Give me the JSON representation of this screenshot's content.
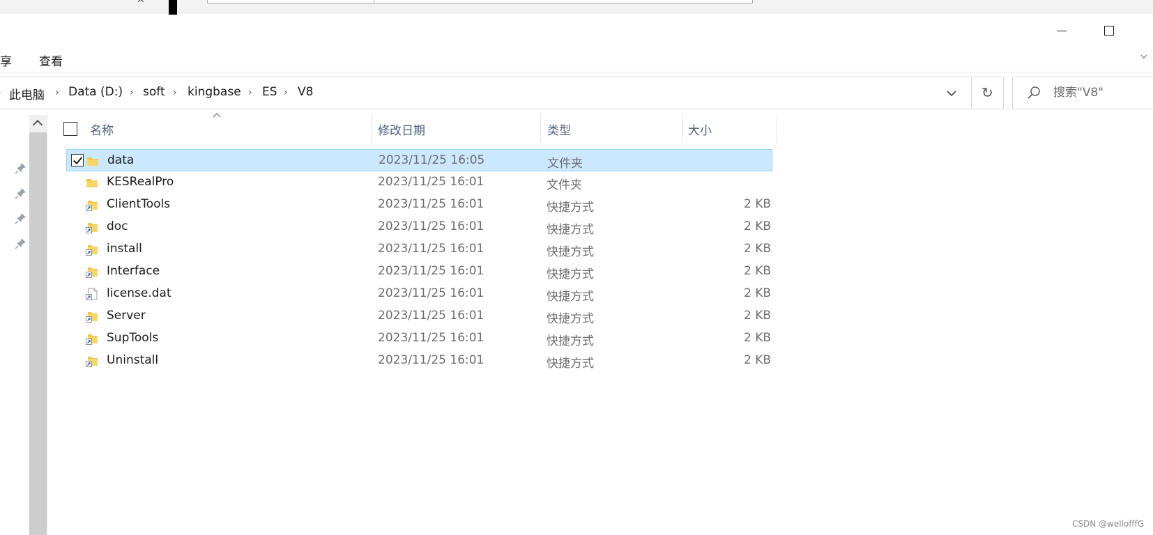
{
  "background_app": {
    "glyph": "✕"
  },
  "ribbon": {
    "tabs": [
      "享",
      "查看"
    ]
  },
  "address_bar": {
    "crumbs": [
      "此电脑",
      "Data (D:)",
      "soft",
      "kingbase",
      "ES",
      "V8"
    ]
  },
  "search": {
    "placeholder": "搜索\"V8\""
  },
  "columns": {
    "name": "名称",
    "date": "修改日期",
    "type": "类型",
    "size": "大小"
  },
  "files": [
    {
      "name": "data",
      "date": "2023/11/25 16:05",
      "type": "文件夹",
      "size": "",
      "icon": "folder-icon",
      "selected": true
    },
    {
      "name": "KESRealPro",
      "date": "2023/11/25 16:01",
      "type": "文件夹",
      "size": "",
      "icon": "folder-icon",
      "selected": false
    },
    {
      "name": "ClientTools",
      "date": "2023/11/25 16:01",
      "type": "快捷方式",
      "size": "2 KB",
      "icon": "folder-shortcut-icon",
      "selected": false
    },
    {
      "name": "doc",
      "date": "2023/11/25 16:01",
      "type": "快捷方式",
      "size": "2 KB",
      "icon": "folder-shortcut-icon",
      "selected": false
    },
    {
      "name": "install",
      "date": "2023/11/25 16:01",
      "type": "快捷方式",
      "size": "2 KB",
      "icon": "folder-shortcut-icon",
      "selected": false
    },
    {
      "name": "Interface",
      "date": "2023/11/25 16:01",
      "type": "快捷方式",
      "size": "2 KB",
      "icon": "folder-shortcut-icon",
      "selected": false
    },
    {
      "name": "license.dat",
      "date": "2023/11/25 16:01",
      "type": "快捷方式",
      "size": "2 KB",
      "icon": "file-shortcut-icon",
      "selected": false
    },
    {
      "name": "Server",
      "date": "2023/11/25 16:01",
      "type": "快捷方式",
      "size": "2 KB",
      "icon": "folder-shortcut-icon",
      "selected": false
    },
    {
      "name": "SupTools",
      "date": "2023/11/25 16:01",
      "type": "快捷方式",
      "size": "2 KB",
      "icon": "folder-shortcut-icon",
      "selected": false
    },
    {
      "name": "Uninstall",
      "date": "2023/11/25 16:01",
      "type": "快捷方式",
      "size": "2 KB",
      "icon": "folder-shortcut-icon",
      "selected": false
    }
  ],
  "watermark": "CSDN @wellofffG",
  "colors": {
    "selection_bg": "#cce8ff",
    "selection_border": "#99d1ff",
    "folder": "#f0c448",
    "header_text": "#4c607a"
  }
}
